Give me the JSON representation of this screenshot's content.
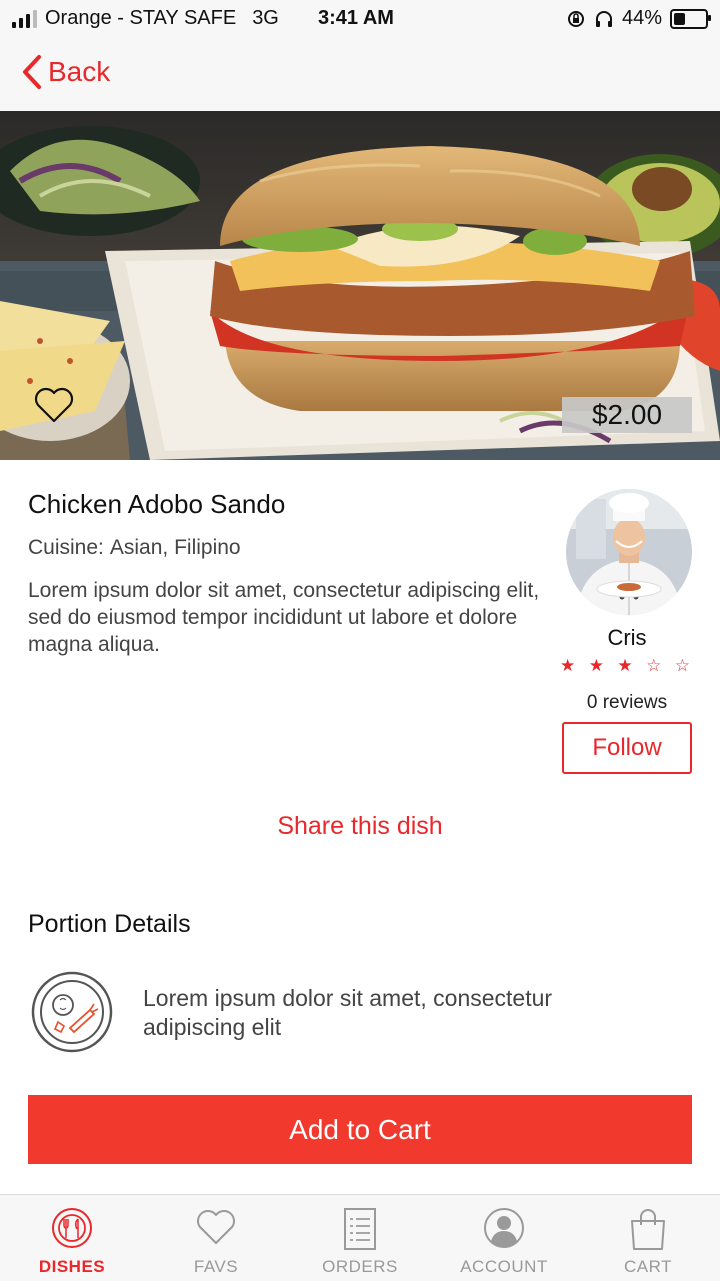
{
  "status_bar": {
    "carrier": "Orange - STAY SAFE",
    "network": "3G",
    "time": "3:41 AM",
    "battery": "44%",
    "battery_level": 0.44
  },
  "nav": {
    "back_label": "Back"
  },
  "hero": {
    "price": "$2.00"
  },
  "dish": {
    "title": "Chicken Adobo Sando",
    "cuisine_label": "Cuisine:",
    "cuisine_value": "Asian, Filipino",
    "description": "Lorem ipsum dolor sit amet, consectetur adipiscing elit, sed do eiusmod tempor incididunt ut labore et dolore magna aliqua."
  },
  "chef": {
    "name": "Cris",
    "rating": 3,
    "max_rating": 5,
    "reviews": "0 reviews",
    "follow_label": "Follow"
  },
  "share_label": "Share this dish",
  "portion": {
    "title": "Portion Details",
    "text": "Lorem ipsum dolor sit amet, consectetur adipiscing elit"
  },
  "add_to_cart_label": "Add to Cart",
  "tabs": [
    {
      "label": "DISHES",
      "icon": "dishes-icon",
      "active": true
    },
    {
      "label": "FAVS",
      "icon": "heart-icon",
      "active": false
    },
    {
      "label": "ORDERS",
      "icon": "orders-icon",
      "active": false
    },
    {
      "label": "ACCOUNT",
      "icon": "account-icon",
      "active": false
    },
    {
      "label": "CART",
      "icon": "bag-icon",
      "active": false
    }
  ],
  "colors": {
    "accent": "#e8282b",
    "button": "#f2392e",
    "inactive": "#9a9a9a"
  }
}
